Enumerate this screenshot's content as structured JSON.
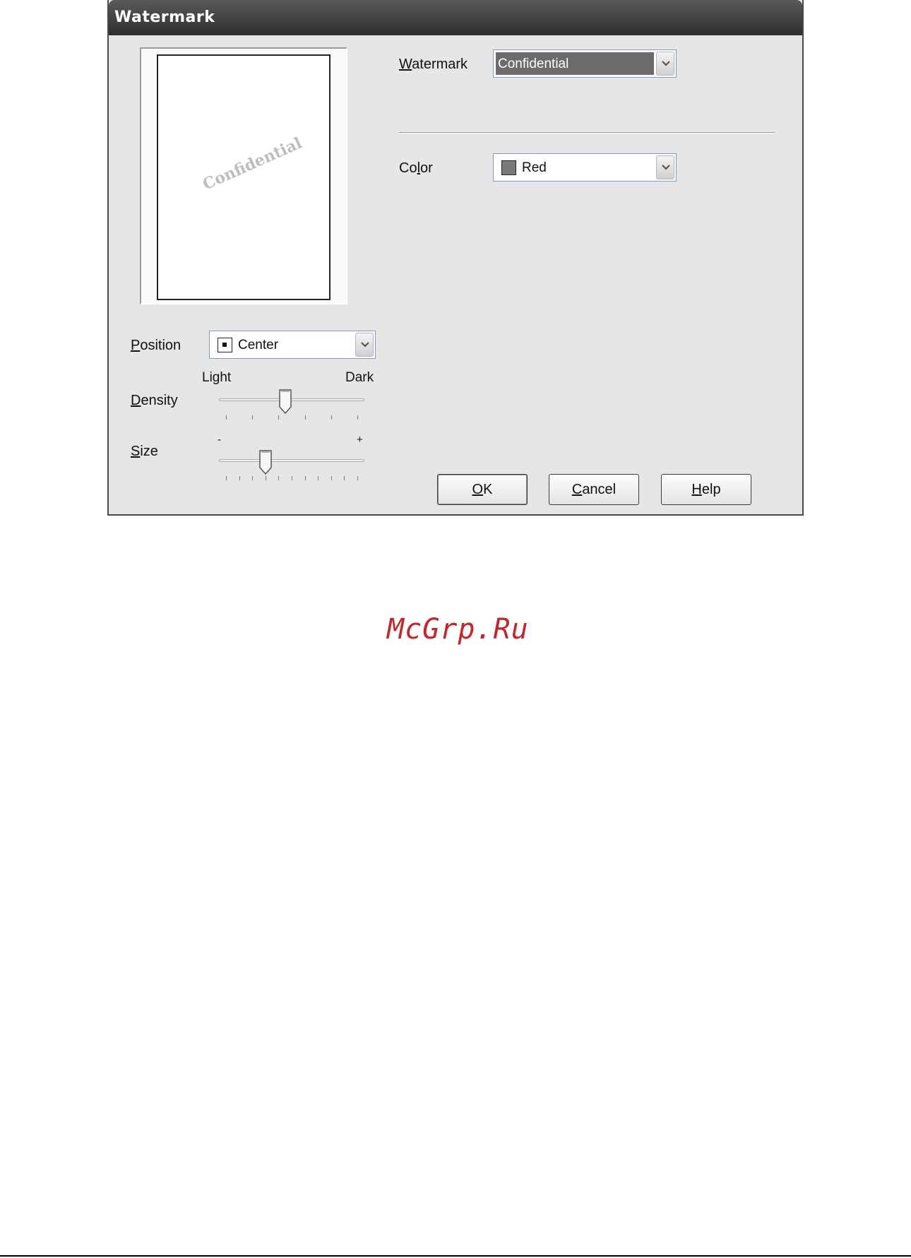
{
  "dialog": {
    "title": "Watermark",
    "watermark": {
      "label_mn": "W",
      "label_rest": "atermark",
      "value": "Confidential"
    },
    "preview": {
      "text": "Confidential"
    },
    "color": {
      "label_pre": "Co",
      "label_mn": "l",
      "label_post": "or",
      "value": "Red",
      "swatch_color": "#7a7a7a"
    },
    "position": {
      "label_mn": "P",
      "label_rest": "osition",
      "value": "Center"
    },
    "density": {
      "label_mn": "D",
      "label_rest": "ensity",
      "min_label": "Light",
      "max_label": "Dark",
      "level": 0.45
    },
    "size": {
      "label_mn": "S",
      "label_rest": "ize",
      "min_label": "-",
      "max_label": "+",
      "level": 0.3
    },
    "buttons": {
      "ok": {
        "mn": "O",
        "rest": "K"
      },
      "cancel": {
        "mn": "C",
        "rest": "ancel"
      },
      "help": {
        "mn": "H",
        "rest": "elp"
      }
    }
  },
  "logo": "McGrp.Ru"
}
